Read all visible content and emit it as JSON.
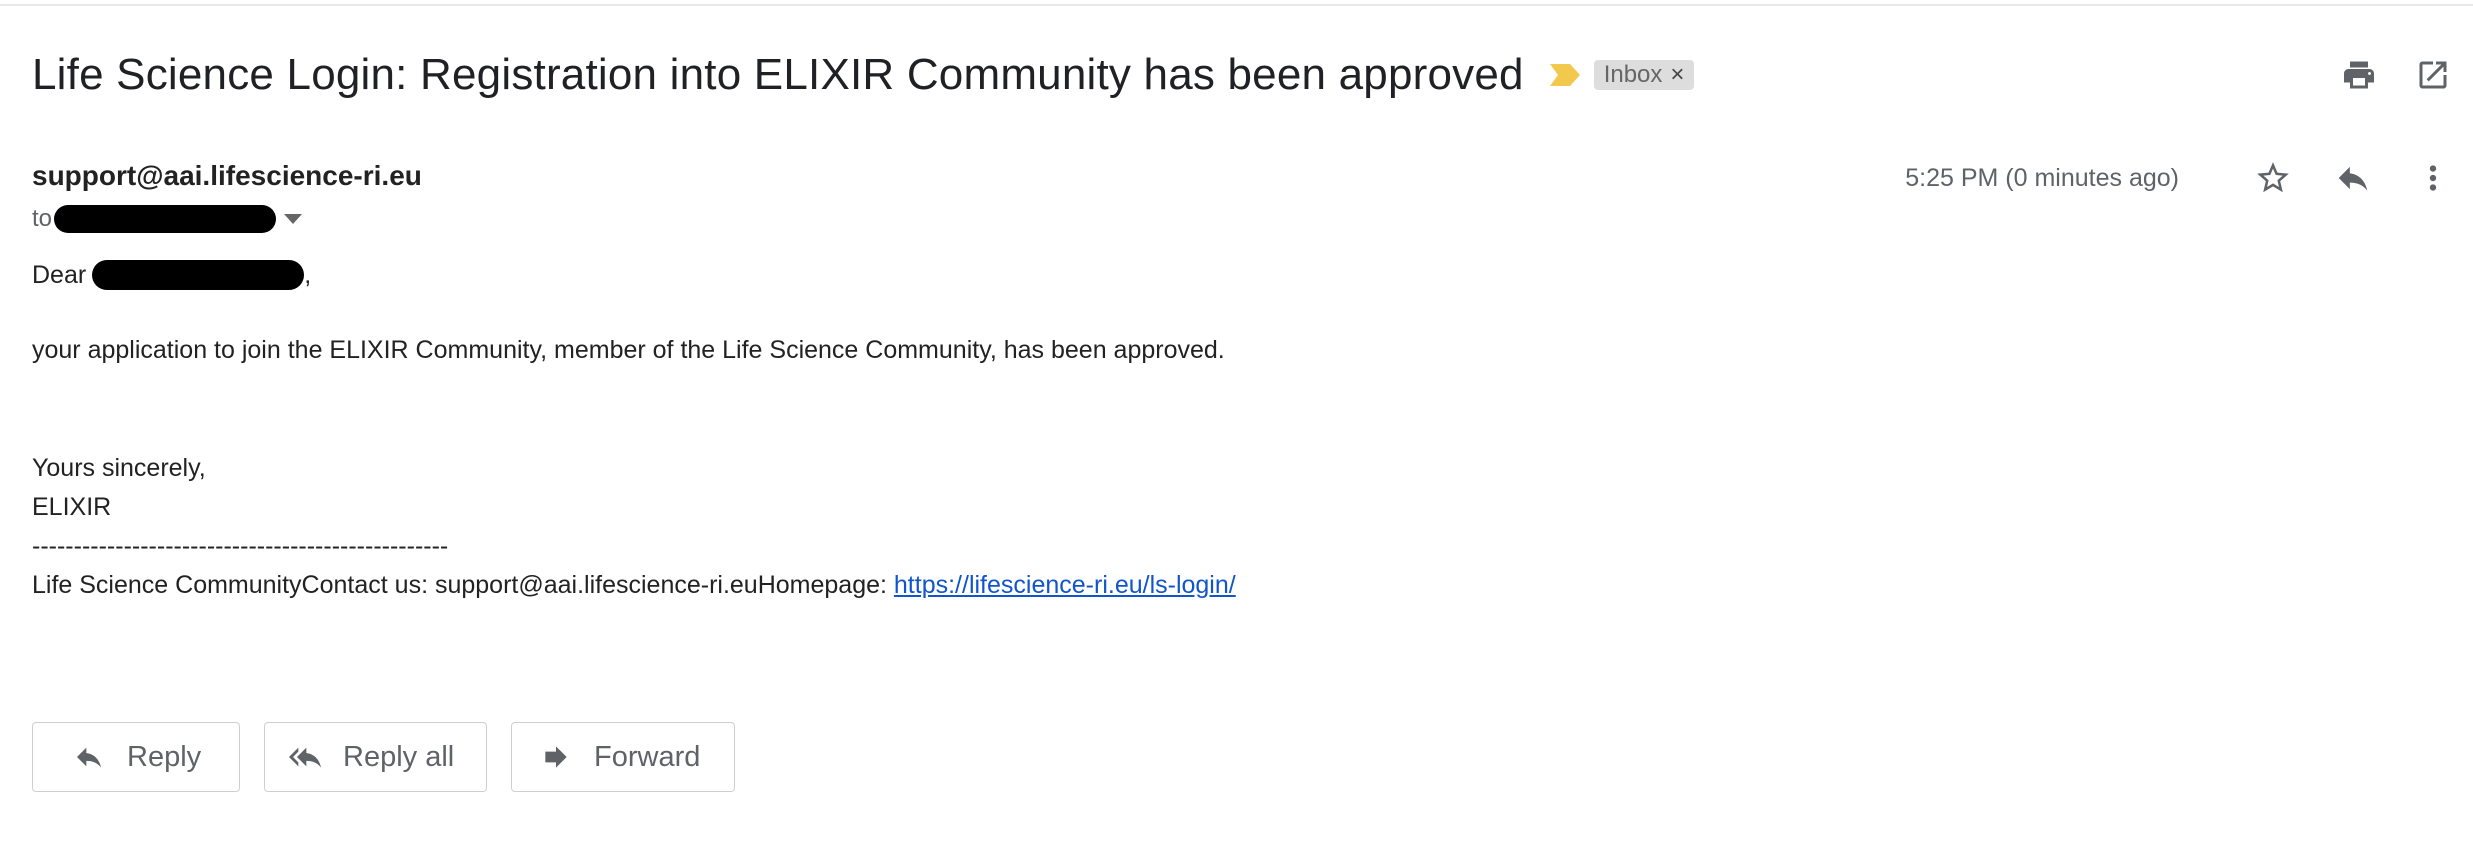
{
  "email": {
    "subject": "Life Science Login: Registration into ELIXIR Community has been approved",
    "label": "Inbox",
    "label_close": "×",
    "sender": "support@aai.lifescience-ri.eu",
    "to_prefix": "to",
    "timestamp": "5:25 PM (0 minutes ago)"
  },
  "body": {
    "greeting_prefix": "Dear",
    "greeting_suffix": ",",
    "line1": "your application to join the ELIXIR Community, member of the Life Science Community, has been approved.",
    "closing": "Yours sincerely,",
    "signature": "ELIXIR",
    "divider": "--------------------------------------------------",
    "footer_text": "Life Science CommunityContact us: support@aai.lifescience-ri.euHomepage: ",
    "footer_link": "https://lifescience-ri.eu/ls-login/"
  },
  "actions": {
    "reply": "Reply",
    "reply_all": "Reply all",
    "forward": "Forward"
  },
  "icons": {
    "print": "print-icon",
    "open_new": "open-in-new-window-icon",
    "star": "star-icon",
    "reply": "reply-icon",
    "more": "more-vertical-icon",
    "importance": "importance-marker-icon"
  },
  "colors": {
    "importance": "#f2c94c",
    "link": "#1155cc"
  }
}
